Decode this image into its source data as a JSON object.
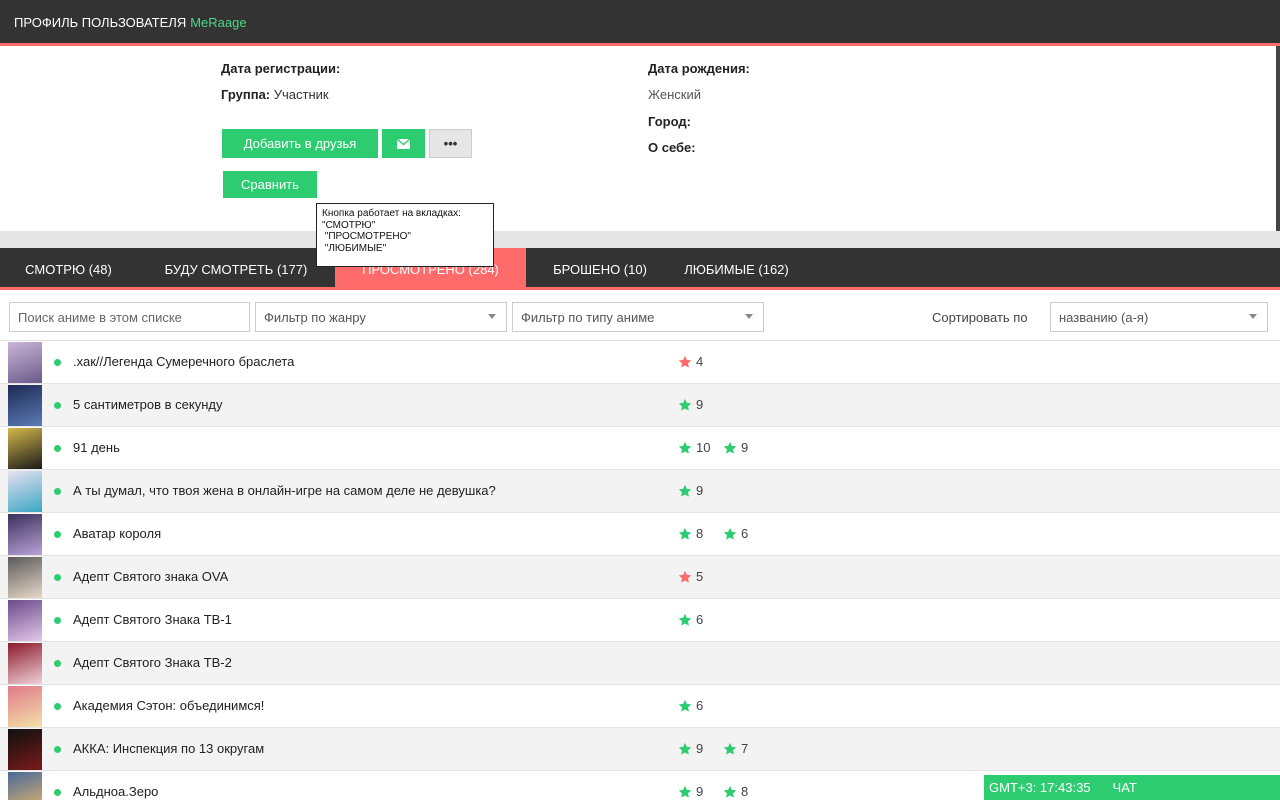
{
  "header": {
    "title": "ПРОФИЛЬ ПОЛЬЗОВАТЕЛЯ",
    "username": "MeRaage"
  },
  "profile": {
    "reg_label": "Дата регистрации:",
    "group_label": "Группа:",
    "group_value": "Участник",
    "birth_label": "Дата рождения:",
    "gender_value": "Женский",
    "city_label": "Город:",
    "about_label": "О себе:"
  },
  "actions": {
    "add_friend": "Добавить в друзья",
    "more": "•••",
    "compare": "Сравнить"
  },
  "tooltip": {
    "lines": [
      "Кнопка работает на вкладках:",
      "\"СМОТРЮ\"",
      " \"ПРОСМОТРЕНО\"",
      " \"ЛЮБИМЫЕ\""
    ]
  },
  "tabs": [
    {
      "label": "СМОТРЮ (48)"
    },
    {
      "label": "БУДУ СМОТРЕТЬ (177)"
    },
    {
      "label": "ПРОСМОТРЕНО (284)"
    },
    {
      "label": "БРОШЕНО (10)"
    },
    {
      "label": "ЛЮБИМЫЕ (162)"
    }
  ],
  "filters": {
    "search_placeholder": "Поиск аниме в этом списке",
    "genre": "Фильтр по жанру",
    "type": "Фильтр по типу аниме",
    "sort_label": "Сортировать по",
    "sort_value": "названию (а-я)"
  },
  "colors": {
    "accent": "#ff6b6b",
    "green": "#2ecc71",
    "dark": "#333333"
  },
  "list": [
    {
      "title": ".хак//Легенда Сумеречного браслета",
      "ratings": [
        {
          "value": "4",
          "color": "red"
        }
      ]
    },
    {
      "title": "5 сантиметров в секунду",
      "ratings": [
        {
          "value": "9",
          "color": "green"
        }
      ]
    },
    {
      "title": "91 день",
      "ratings": [
        {
          "value": "10",
          "color": "green"
        },
        {
          "value": "9",
          "color": "green"
        }
      ]
    },
    {
      "title": "А ты думал, что твоя жена в онлайн-игре на самом деле не девушка?",
      "ratings": [
        {
          "value": "9",
          "color": "green"
        }
      ]
    },
    {
      "title": "Аватар короля",
      "ratings": [
        {
          "value": "8",
          "color": "green"
        },
        {
          "value": "6",
          "color": "green"
        }
      ]
    },
    {
      "title": "Адепт Святого знака OVA",
      "ratings": [
        {
          "value": "5",
          "color": "red"
        }
      ]
    },
    {
      "title": "Адепт Святого Знака ТВ-1",
      "ratings": [
        {
          "value": "6",
          "color": "green"
        }
      ]
    },
    {
      "title": "Адепт Святого Знака ТВ-2",
      "ratings": []
    },
    {
      "title": "Академия Сэтон: объединимся!",
      "ratings": [
        {
          "value": "6",
          "color": "green"
        }
      ]
    },
    {
      "title": "АККА: Инспекция по 13 округам",
      "ratings": [
        {
          "value": "9",
          "color": "green"
        },
        {
          "value": "7",
          "color": "green"
        }
      ]
    },
    {
      "title": "Альдноа.Зеро",
      "ratings": [
        {
          "value": "9",
          "color": "green"
        },
        {
          "value": "8",
          "color": "green"
        }
      ]
    }
  ],
  "chat": {
    "time": "GMT+3: 17:43:35",
    "label": "ЧАТ"
  }
}
